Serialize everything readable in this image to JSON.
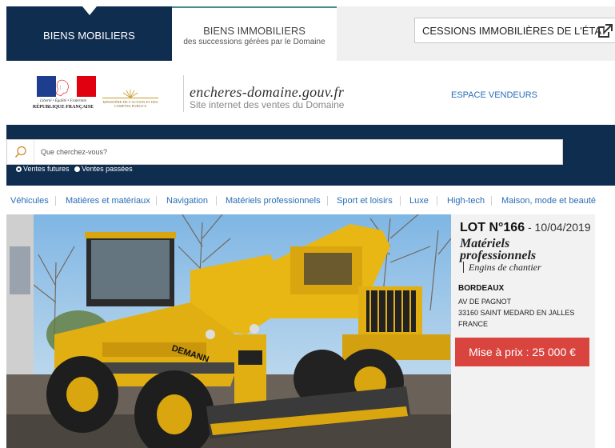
{
  "topbar": {
    "tab_mobiliers": "BIENS MOBILIERS",
    "tab_immobiliers_title": "BIENS IMMOBILIERS",
    "tab_immobiliers_sub": "des successions gérées par le Domaine",
    "cessions_label": "CESSIONS IMMOBILIÈRES DE L'ÉTAT"
  },
  "header": {
    "motto": "Liberté • Égalité • Fraternité",
    "republique": "RÉPUBLIQUE FRANÇAISE",
    "ministere": "MINISTÈRE DE L'ACTION ET DES COMPTES PUBLICS",
    "site_title": "encheres-domaine.gouv.fr",
    "site_subtitle": "Site internet des ventes du Domaine",
    "espace_vendeurs": "ESPACE VENDEURS"
  },
  "search": {
    "placeholder": "Que cherchez-vous?",
    "radio_future": "Ventes futures",
    "radio_past": "Ventes passées"
  },
  "categories": [
    "Véhicules",
    "Matières et matériaux",
    "Navigation",
    "Matériels professionnels",
    "Sport et loisirs",
    "Luxe",
    "High-tech",
    "Maison, mode et beauté"
  ],
  "lot": {
    "number": "LOT N°166",
    "date": " - 10/04/2019",
    "category": "Matériels professionnels",
    "subcategory": "Engins de chantier",
    "city": "BORDEAUX",
    "address_line1": "AV DE PAGNOT",
    "address_line2": "33160 SAINT MEDARD EN JALLES",
    "address_line3": "FRANCE",
    "price": "Mise à prix : 25 000 €",
    "photo_brand_text": "DEMANN"
  },
  "colors": {
    "navy": "#0f2d4f",
    "link_blue": "#2a6db5",
    "price_red": "#d9443f",
    "machine_yellow": "#e8b713"
  }
}
